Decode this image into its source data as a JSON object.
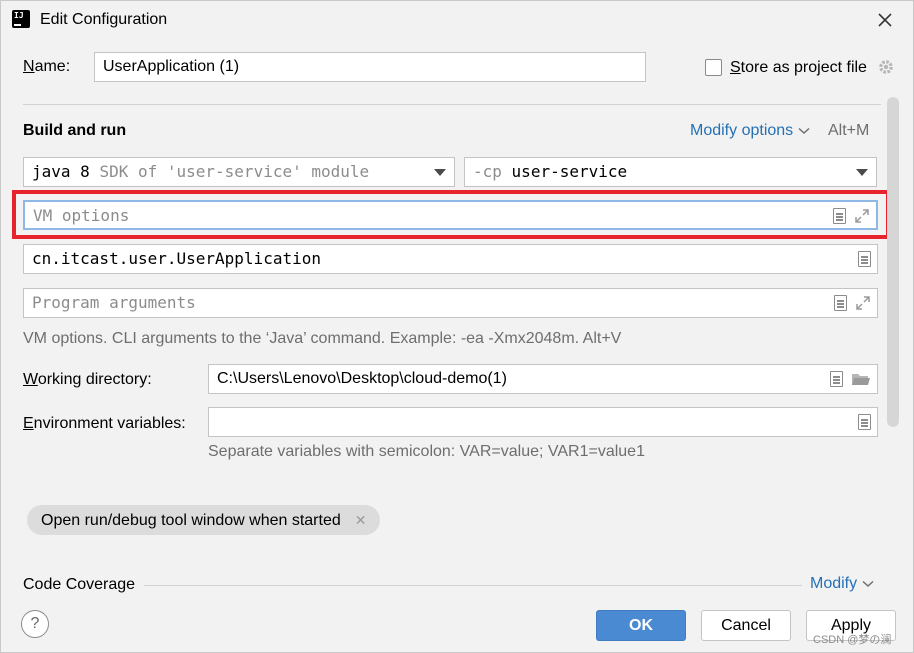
{
  "window": {
    "title": "Edit Configuration",
    "app_icon_text": "IJ"
  },
  "name_row": {
    "label_key": "N",
    "label_rest": "ame:",
    "value": "UserApplication (1)"
  },
  "store": {
    "label_key": "S",
    "label_rest": "tore as project file",
    "checked": false
  },
  "build_run": {
    "title": "Build and run",
    "modify_link": "Modify options",
    "shortcut": "Alt+M",
    "sdk_java": "java 8",
    "sdk_rest": "SDK of 'user-service' module",
    "cp_prefix": "-cp",
    "cp_value": "user-service",
    "vm_placeholder": "VM options",
    "main_class": "cn.itcast.user.UserApplication",
    "program_placeholder": "Program arguments",
    "hint": "VM options. CLI arguments to the ‘Java’ command. Example: -ea -Xmx2048m. Alt+V"
  },
  "working_dir": {
    "label_key": "W",
    "label_rest": "orking directory:",
    "value": "C:\\Users\\Lenovo\\Desktop\\cloud-demo(1)"
  },
  "env_vars": {
    "label_key": "E",
    "label_rest": "nvironment variables:",
    "value": "",
    "hint": "Separate variables with semicolon: VAR=value; VAR1=value1"
  },
  "chip": {
    "label": "Open run/debug tool window when started"
  },
  "coverage": {
    "title": "Code Coverage",
    "modify_link": "Modify"
  },
  "buttons": {
    "help": "?",
    "ok": "OK",
    "cancel": "Cancel",
    "apply": "Apply"
  },
  "watermark": "CSDN @梦の澜",
  "colors": {
    "accent": "#4a8ad2",
    "link": "#2470b3",
    "highlight_box": "#e8232e"
  }
}
